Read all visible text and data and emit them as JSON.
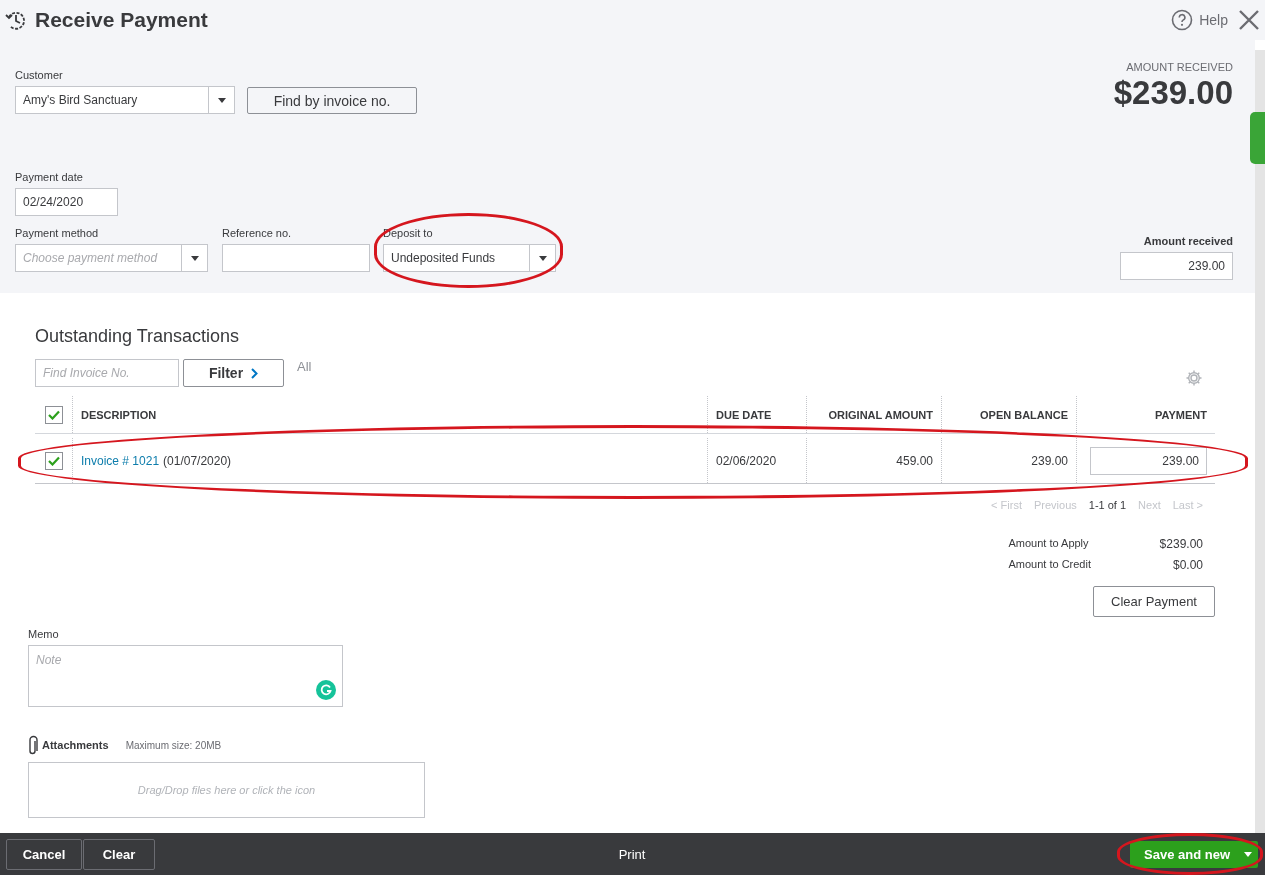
{
  "header": {
    "title": "Receive Payment",
    "help": "Help"
  },
  "amount_received": {
    "label": "AMOUNT RECEIVED",
    "value": "$239.00"
  },
  "customer": {
    "label": "Customer",
    "value": "Amy's Bird Sanctuary"
  },
  "find_by_invoice_button": "Find by invoice no.",
  "payment_date": {
    "label": "Payment date",
    "value": "02/24/2020"
  },
  "payment_method": {
    "label": "Payment method",
    "placeholder": "Choose payment method"
  },
  "reference_no": {
    "label": "Reference no."
  },
  "deposit_to": {
    "label": "Deposit to",
    "value": "Undeposited Funds",
    "highlighted": true
  },
  "amount_received_field": {
    "label": "Amount received",
    "value": "239.00"
  },
  "outstanding": {
    "title": "Outstanding Transactions",
    "search": {
      "placeholder": "Find Invoice No."
    },
    "filter_button": "Filter",
    "filter_value": "All",
    "table": {
      "select_all_checked": true,
      "columns": [
        "DESCRIPTION",
        "DUE DATE",
        "ORIGINAL AMOUNT",
        "OPEN BALANCE",
        "PAYMENT"
      ],
      "rows": [
        {
          "checked": true,
          "highlighted": true,
          "link": "Invoice # 1021",
          "description": "(01/07/2020)",
          "due_date": "02/06/2020",
          "original_amount": "459.00",
          "open_balance": "239.00",
          "payment": "239.00"
        }
      ]
    },
    "pagination": [
      {
        "kind": "link",
        "label": "< First",
        "disabled": true
      },
      {
        "kind": "link",
        "label": "Previous",
        "disabled": true
      },
      {
        "kind": "range",
        "label": "1-1 of 1"
      },
      {
        "kind": "link",
        "label": "Next",
        "disabled": true
      },
      {
        "kind": "link",
        "label": "Last >",
        "disabled": true
      }
    ],
    "totals": [
      {
        "label": "Amount to Apply",
        "value": "$239.00"
      },
      {
        "label": "Amount to Credit",
        "value": "$0.00"
      }
    ],
    "clear_payment_button": "Clear Payment"
  },
  "memo": {
    "label": "Memo",
    "placeholder": "Note"
  },
  "attachments": {
    "label": "Attachments",
    "max_size": "Maximum size: 20MB",
    "drop_hint": "Drag/Drop files here or click the icon"
  },
  "footer": {
    "buttons": [
      {
        "label": "Cancel"
      },
      {
        "label": "Clear"
      }
    ],
    "print": "Print",
    "save": {
      "label": "Save and new",
      "highlighted": true
    }
  }
}
